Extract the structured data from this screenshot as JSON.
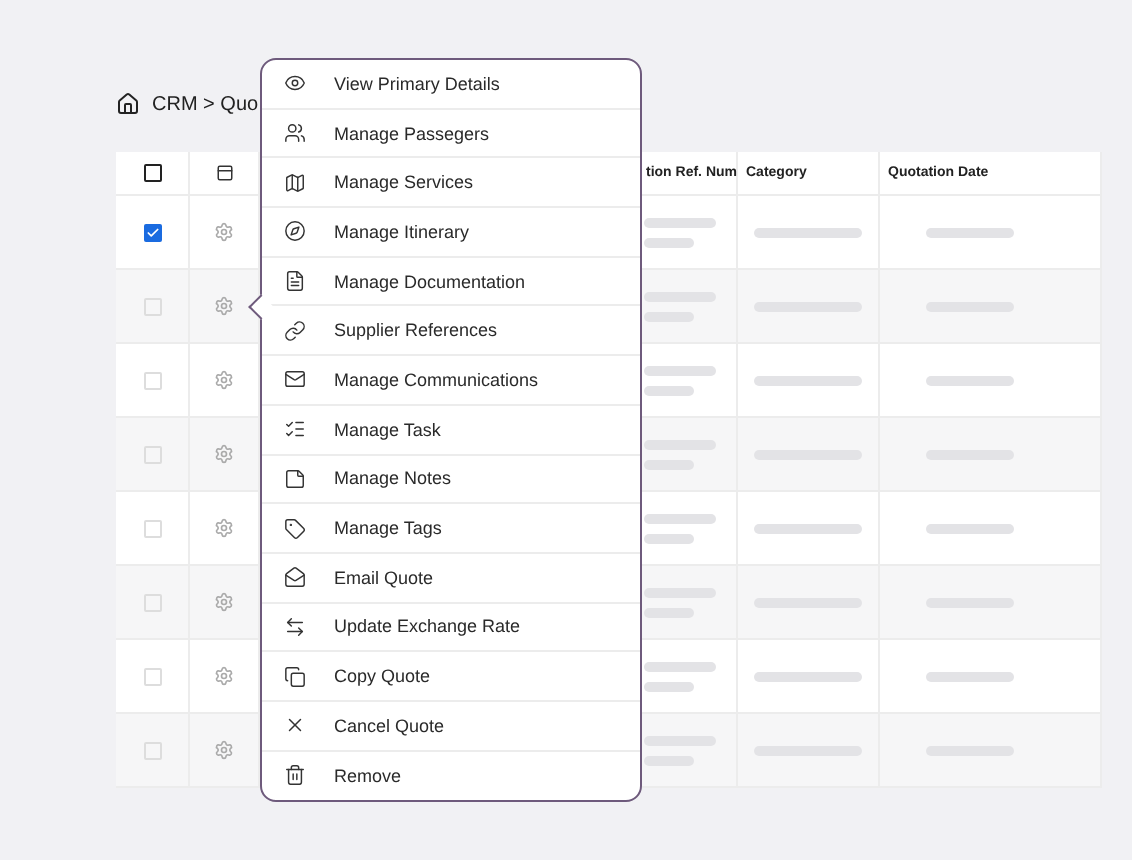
{
  "breadcrumb": {
    "text": "CRM > Quo"
  },
  "table": {
    "select_all": {
      "checked": false
    },
    "columns": [
      "tion Ref. Num",
      "Category",
      "Quotation Date"
    ],
    "rows": [
      {
        "checked": true,
        "menu_open": false
      },
      {
        "checked": false,
        "menu_open": true
      },
      {
        "checked": false,
        "menu_open": false
      },
      {
        "checked": false,
        "menu_open": false
      },
      {
        "checked": false,
        "menu_open": false
      },
      {
        "checked": false,
        "menu_open": false
      },
      {
        "checked": false,
        "menu_open": false
      },
      {
        "checked": false,
        "menu_open": false
      }
    ]
  },
  "menu": {
    "items": [
      "View Primary Details",
      "Manage Passegers",
      "Manage Services",
      "Manage Itinerary",
      "Manage Documentation",
      "Supplier References",
      "Manage Communications",
      "Manage Task",
      "Manage Notes",
      "Manage Tags",
      "Email Quote",
      "Update Exchange Rate",
      "Copy Quote",
      "Cancel Quote",
      "Remove"
    ]
  }
}
